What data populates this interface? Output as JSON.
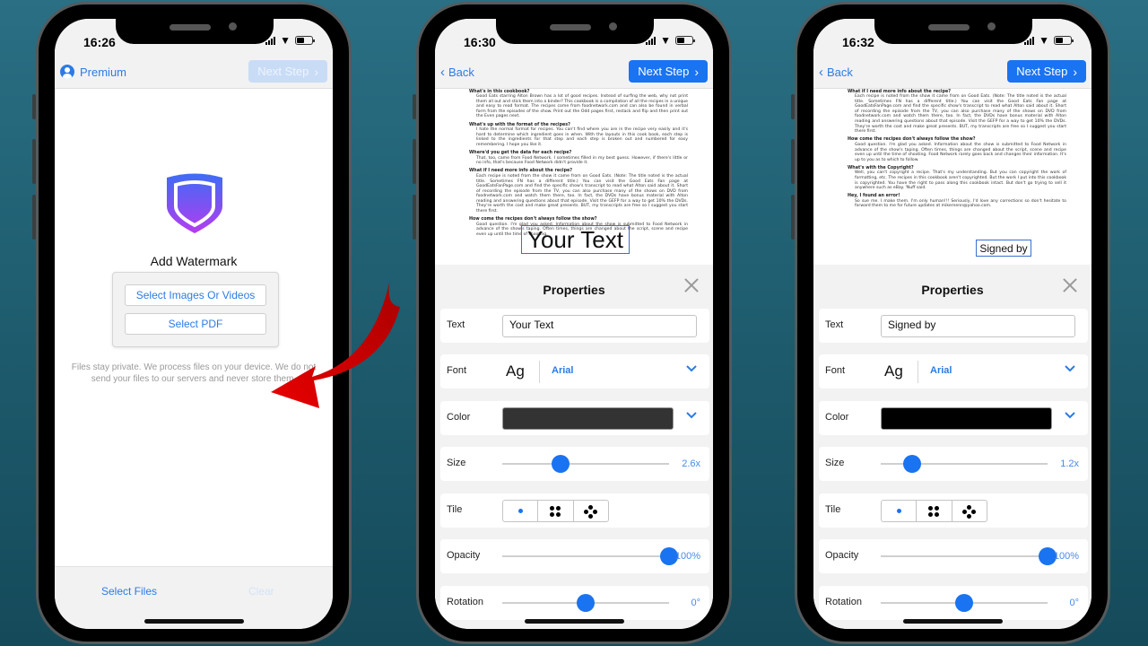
{
  "colors": {
    "accent": "#1a73f0",
    "link": "#2c7be5",
    "disabled_button": "#c9dcf6",
    "annotation_arrow": "#d40000",
    "background": "#1f5f72"
  },
  "phones": [
    {
      "status_time": "16:26",
      "nav": {
        "left_icon": "user-circle-icon",
        "left_label": "Premium",
        "next_label": "Next Step",
        "next_enabled": false
      },
      "main": {
        "logo_icon": "shield-icon",
        "title": "Add Watermark",
        "options": [
          "Select Images Or Videos",
          "Select PDF"
        ],
        "privacy_note": "Files stay private. We process files on your device. We do not send your files to our servers and never store them."
      },
      "bottom_bar": {
        "select_files": "Select Files",
        "clear": "Clear"
      }
    },
    {
      "status_time": "16:30",
      "nav": {
        "back_label": "Back",
        "next_label": "Next Step",
        "next_enabled": true
      },
      "document": {
        "sections": [
          {
            "heading": "What's in this cookbook?",
            "body": "Good Eats starring Alton Brown has a lot of good recipes. Instead of surfing the web, why not print them all out and stick them into a binder? This cookbook is a compilation of all the recipes in a unique and easy to read format. The recipes come from foodnetwork.com and can also be found in verbal form from the episodes of the show. Print out the Odd pages first, restack and flip and then print out the Even pages next."
          },
          {
            "heading": "What's up with the format of the recipes?",
            "body": "I hate the normal format for recipes. You can't find where you are in the recipe very easily and it's hard to determine which ingredient goes in when. With the layouts in this cook book, each step is linked to the ingredients for that step and each step is broken out and numbered for easy remembering. I hope you like it."
          },
          {
            "heading": "Where'd you get the data for each recipe?",
            "body": "That, too, came from Food Network. I sometimes filled in my best guess. However, if there's little or no info, that's because Food Network didn't provide it."
          },
          {
            "heading": "What if I need more info about the recipe?",
            "body": "Each recipe is noted from the show it came from on Good Eats. (Note: The title noted is the actual title. Sometimes FN has a different title.) You can visit the Good Eats Fan page at GoodEatsFanPage.com and find the specific show's transcript to read what Alton said about it. Short of recording the episode from the TV, you can also purchase many of the shows on DVD from foodnetwork.com and watch them there, too. In fact, the DVDs have bonus material with Alton reading and answering questions about that episode. Visit the GEFP for a way to get 10% the DVDs. They're worth the cost and make great presents. BUT, my transcripts are free so I suggest you start there first."
          },
          {
            "heading": "How come the recipes don't always follow the show?",
            "body": "Good question. I'm glad you asked. Information about the show is submitted to Food Network in advance of the show's taping. Often times, things are changed about the script, scene and recipe even up until the time of shooting."
          }
        ],
        "watermark_text": "Your Text"
      },
      "properties": {
        "title": "Properties",
        "text_label": "Text",
        "text_value": "Your Text",
        "font_label": "Font",
        "font_sample": "Ag",
        "font_name": "Arial",
        "color_label": "Color",
        "color_value": "#333333",
        "size_label": "Size",
        "size_value": "2.6x",
        "size_fraction": 0.35,
        "tile_label": "Tile",
        "tile_selected": 0,
        "opacity_label": "Opacity",
        "opacity_value": "100%",
        "opacity_fraction": 1.0,
        "rotation_label": "Rotation",
        "rotation_value": "0°",
        "rotation_fraction": 0.5
      }
    },
    {
      "status_time": "16:32",
      "nav": {
        "back_label": "Back",
        "next_label": "Next Step",
        "next_enabled": true
      },
      "document": {
        "sections": [
          {
            "heading": "What if I need more info about the recipe?",
            "body": "Each recipe is noted from the show it came from on Good Eats. (Note: The title noted is the actual title. Sometimes FN has a different title.) You can visit the Good Eats Fan page at GoodEatsFanPage.com and find the specific show's transcript to read what Alton said about it. Short of recording the episode from the TV, you can also purchase many of the shows on DVD from foodnetwork.com and watch them there, too. In fact, the DVDs have bonus material with Alton reading and answering questions about that episode. Visit the GEFP for a way to get 10% the DVDs. They're worth the cost and make great presents. BUT, my transcripts are free so I suggest you start there first."
          },
          {
            "heading": "How come the recipes don't always follow the show?",
            "body": "Good question. I'm glad you asked. Information about the show is submitted to Food Network in advance of the show's taping. Often times, things are changed about the script, scene and recipe even up until the time of shooting. Food Network rarely goes back and changes their information. It's up to you as to which to follow."
          },
          {
            "heading": "What's with the Copyright?",
            "body": "Well, you can't copyright a recipe. That's my understanding. But you can copyright the work of formatting, etc. The recipes in this cookbook aren't copyrighted. But the work I put into this cookbook is copyrighted. You have the right to pass along this cookbook intact. But don't go trying to sell it anywhere such as eBay. 'Nuff said."
          },
          {
            "heading": "Hey, I found an error!",
            "body": "So sue me. I make them. I'm only human!!! Seriously, I'd love any corrections so don't hesitate to forward them to me for future updates at mikernenn@yahoo.com."
          }
        ],
        "watermark_text": "Signed by"
      },
      "properties": {
        "title": "Properties",
        "text_label": "Text",
        "text_value": "Signed by",
        "font_label": "Font",
        "font_sample": "Ag",
        "font_name": "Arial",
        "color_label": "Color",
        "color_value": "#000000",
        "size_label": "Size",
        "size_value": "1.2x",
        "size_fraction": 0.19,
        "tile_label": "Tile",
        "tile_selected": 0,
        "opacity_label": "Opacity",
        "opacity_value": "100%",
        "opacity_fraction": 1.0,
        "rotation_label": "Rotation",
        "rotation_value": "0°",
        "rotation_fraction": 0.5
      }
    }
  ]
}
